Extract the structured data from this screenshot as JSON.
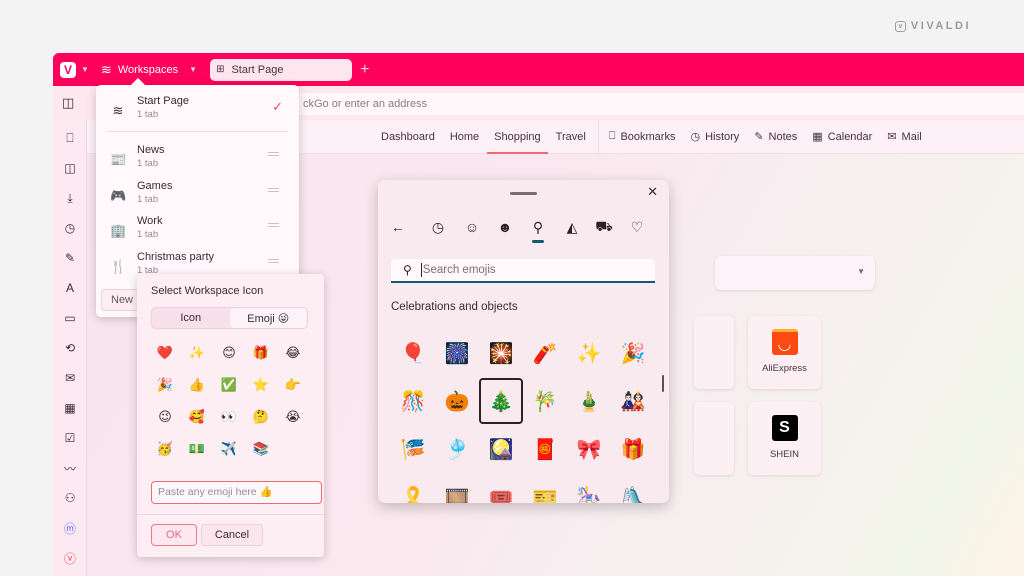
{
  "brand": {
    "logo_icon": "vivaldi-logo-icon",
    "name": "VIVALDI"
  },
  "tabbar": {
    "app_menu_icon": "vivaldi-menu-icon",
    "workspaces_label": "Workspaces",
    "active_tab": "Start Page",
    "new_tab_label": "+"
  },
  "address_bar": {
    "placeholder": "Search DuckDuckGo or enter an address",
    "visible_text": "ckGo or enter an address"
  },
  "navbar": {
    "items": [
      {
        "label": "Dashboard",
        "active": false
      },
      {
        "label": "Home",
        "active": false
      },
      {
        "label": "Shopping",
        "active": true
      },
      {
        "label": "Travel",
        "active": false
      }
    ],
    "panels": [
      {
        "label": "Bookmarks",
        "icon": "bookmark-icon"
      },
      {
        "label": "History",
        "icon": "history-icon"
      },
      {
        "label": "Notes",
        "icon": "notes-icon"
      },
      {
        "label": "Calendar",
        "icon": "calendar-icon"
      },
      {
        "label": "Mail",
        "icon": "mail-icon"
      }
    ]
  },
  "sidebar": {
    "items": [
      {
        "name": "bookmarks",
        "icon": "bookmark-icon"
      },
      {
        "name": "reading-list",
        "icon": "reading-list-icon"
      },
      {
        "name": "downloads",
        "icon": "download-icon"
      },
      {
        "name": "history",
        "icon": "history-icon"
      },
      {
        "name": "notes",
        "icon": "notes-icon"
      },
      {
        "name": "translate",
        "icon": "translate-icon"
      },
      {
        "name": "window",
        "icon": "window-icon"
      },
      {
        "name": "sync",
        "icon": "sync-icon"
      },
      {
        "name": "mail",
        "icon": "mail-icon"
      },
      {
        "name": "calendar",
        "icon": "calendar-icon"
      },
      {
        "name": "tasks",
        "icon": "tasks-icon"
      },
      {
        "name": "feeds",
        "icon": "rss-icon"
      },
      {
        "name": "contacts",
        "icon": "contacts-icon"
      },
      {
        "name": "mastodon",
        "icon": "mastodon-icon"
      },
      {
        "name": "vivaldi-social",
        "icon": "vivaldi-icon"
      }
    ]
  },
  "workspaces_menu": {
    "current": {
      "name": "Start Page",
      "count": "1 tab",
      "selected": true
    },
    "items": [
      {
        "name": "News",
        "count": "1 tab",
        "icon": "newspaper-icon"
      },
      {
        "name": "Games",
        "count": "1 tab",
        "icon": "game-controller-icon"
      },
      {
        "name": "Work",
        "count": "1 tab",
        "icon": "office-building-icon"
      },
      {
        "name": "Christmas party",
        "count": "1 tab",
        "icon": "fork-knife-icon"
      }
    ],
    "new_button": "New Workspace"
  },
  "icon_picker": {
    "title": "Select Workspace Icon",
    "tabs": [
      {
        "label": "Icon",
        "active": false
      },
      {
        "label": "Emoji 😜",
        "active": true
      }
    ],
    "emojis": [
      "❤️",
      "✨",
      "😊",
      "🎁",
      "😂",
      "🎉",
      "👍",
      "✅",
      "⭐",
      "👉",
      "😉",
      "🥰",
      "👀",
      "🤔",
      "😭",
      "🥳",
      "💵",
      "✈️",
      "📚"
    ],
    "input_placeholder": "Paste any emoji here 👍",
    "ok": "OK",
    "cancel": "Cancel"
  },
  "emoji_panel": {
    "tabs": [
      {
        "icon": "back-arrow-icon",
        "glyph": "←"
      },
      {
        "icon": "recent-icon",
        "glyph": "◷"
      },
      {
        "icon": "smiley-icon",
        "glyph": "☺"
      },
      {
        "icon": "people-icon",
        "glyph": "☻"
      },
      {
        "icon": "balloon-icon",
        "glyph": "⚲",
        "active": true
      },
      {
        "icon": "food-icon",
        "glyph": "◭"
      },
      {
        "icon": "car-icon",
        "glyph": "⛟"
      },
      {
        "icon": "heart-icon",
        "glyph": "♡"
      }
    ],
    "search_placeholder": "Search emojis",
    "section": "Celebrations and objects",
    "grid": [
      "🎈",
      "🎆",
      "🎇",
      "🧨",
      "✨",
      "🎉",
      "🎊",
      "🎃",
      "🎄",
      "🎋",
      "🎍",
      "🎎",
      "🎏",
      "🎐",
      "🎑",
      "🧧",
      "🎀",
      "🎁",
      "🎗️",
      "🎞️",
      "🎟️",
      "🎫",
      "🎠",
      "🛝"
    ],
    "selected_index": 8
  },
  "speed_dial": {
    "tiles": [
      {
        "label": "AliExpress",
        "glyph": "◡"
      },
      {
        "label": "SHEIN",
        "glyph": "S"
      }
    ]
  }
}
